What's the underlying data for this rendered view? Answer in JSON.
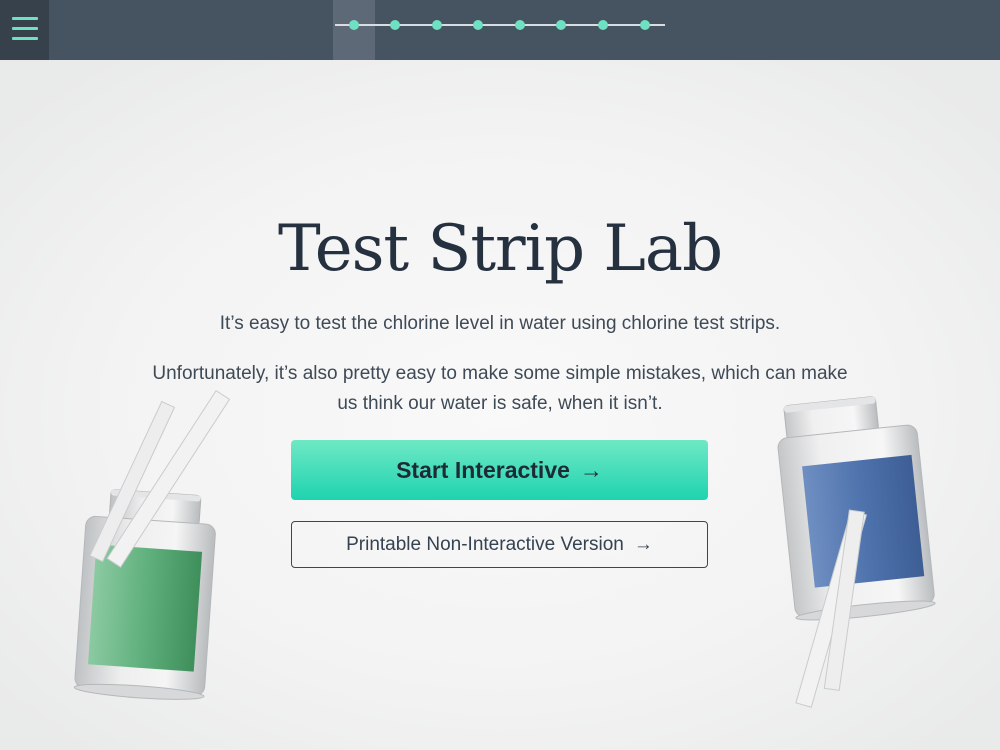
{
  "nav": {
    "menu_icon": "hamburger-icon",
    "steps_total": 8,
    "current_step": 1
  },
  "hero": {
    "title": "Test Strip Lab",
    "paragraph_1": "It’s easy to test the chlorine level in water using chlorine test strips.",
    "paragraph_2": "Unfortunately, it’s also pretty easy to make some simple mistakes, which can make us think our water is safe, when it isn’t."
  },
  "actions": {
    "start_label": "Start Interactive",
    "printable_label": "Printable Non-Interactive Version",
    "arrow": "→"
  },
  "colors": {
    "topbar": "#465361",
    "accent": "#6fe0c2",
    "button_primary": "#1fd3b0",
    "green_label": "#4fa771",
    "blue_label": "#4a6fa8"
  }
}
